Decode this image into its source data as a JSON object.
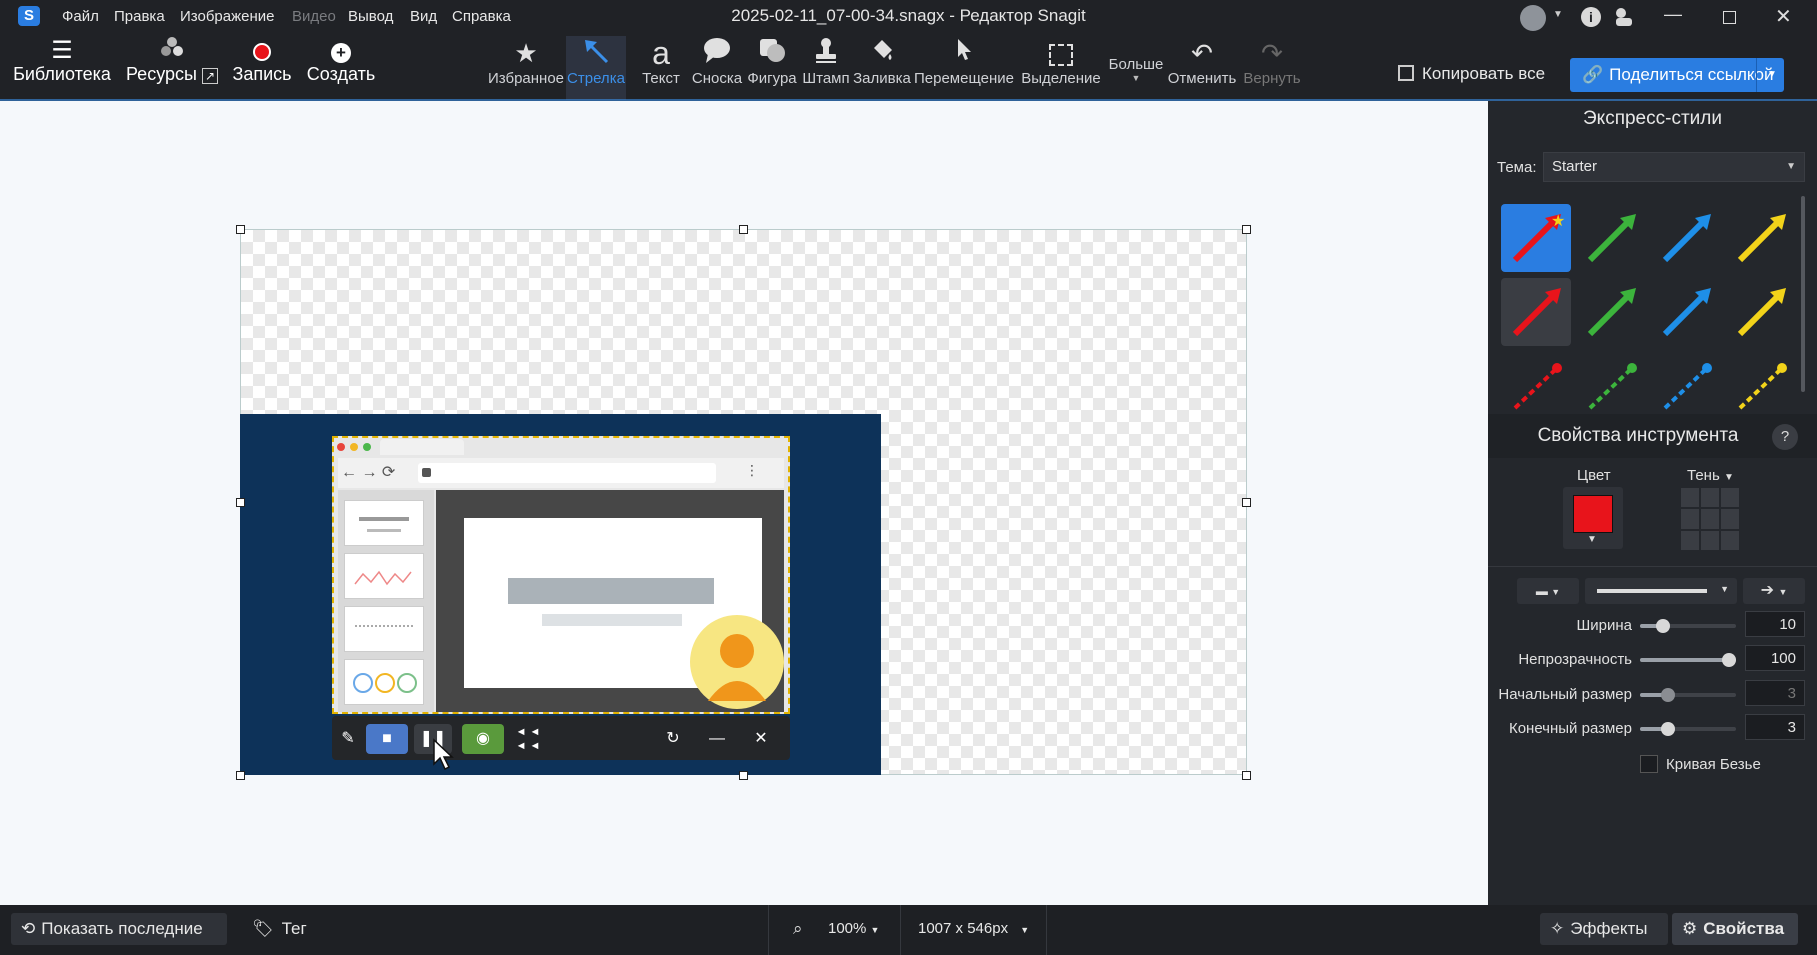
{
  "window": {
    "title": "2025-02-11_07-00-34.snagx - Редактор Snagit",
    "logo": "S"
  },
  "menu": [
    {
      "label": "Файл",
      "enabled": true
    },
    {
      "label": "Правка",
      "enabled": true
    },
    {
      "label": "Изображение",
      "enabled": true
    },
    {
      "label": "Видео",
      "enabled": false
    },
    {
      "label": "Вывод",
      "enabled": true
    },
    {
      "label": "Вид",
      "enabled": true
    },
    {
      "label": "Справка",
      "enabled": true
    }
  ],
  "left_actions": {
    "library": "Библиотека",
    "resources": "Ресурсы",
    "record": "Запись",
    "create": "Создать"
  },
  "tools": {
    "favorites": "Избранное",
    "arrow": "Стрелка",
    "text": "Текст",
    "callout": "Сноска",
    "shape": "Фигура",
    "stamp": "Штамп",
    "fill": "Заливка",
    "move": "Перемещение",
    "selection": "Выделение",
    "more": "Больше",
    "undo": "Отменить",
    "redo": "Вернуть",
    "text_glyph": "a"
  },
  "right_actions": {
    "copy_all": "Копировать все",
    "share_link": "Поделиться ссылкой"
  },
  "quick_styles": {
    "title": "Экспресс-стили",
    "theme_label": "Тема:",
    "theme_value": "Starter",
    "colors": [
      "#e8141b",
      "#3cb43c",
      "#1e8fe8",
      "#f2d31a"
    ],
    "accent": "#2a7de1"
  },
  "tool_properties": {
    "title": "Свойства инструмента",
    "help": "?",
    "color_label": "Цвет",
    "color_value": "#e8141b",
    "shadow_label": "Тень",
    "width_label": "Ширина",
    "width_value": "10",
    "width_level": 0.2,
    "opacity_label": "Непрозрачность",
    "opacity_value": "100",
    "opacity_level": 1.0,
    "start_size_label": "Начальный размер",
    "start_size_value": "3",
    "start_size_level": 0.25,
    "end_size_label": "Конечный размер",
    "end_size_value": "3",
    "end_size_level": 0.25,
    "bezier_label": "Кривая Безье",
    "bezier_checked": false
  },
  "status": {
    "show_recent": "Показать последние",
    "tag": "Тег",
    "zoom": "100%",
    "dimensions": "1007 x 546px",
    "effects": "Эффекты",
    "properties": "Свойства"
  }
}
